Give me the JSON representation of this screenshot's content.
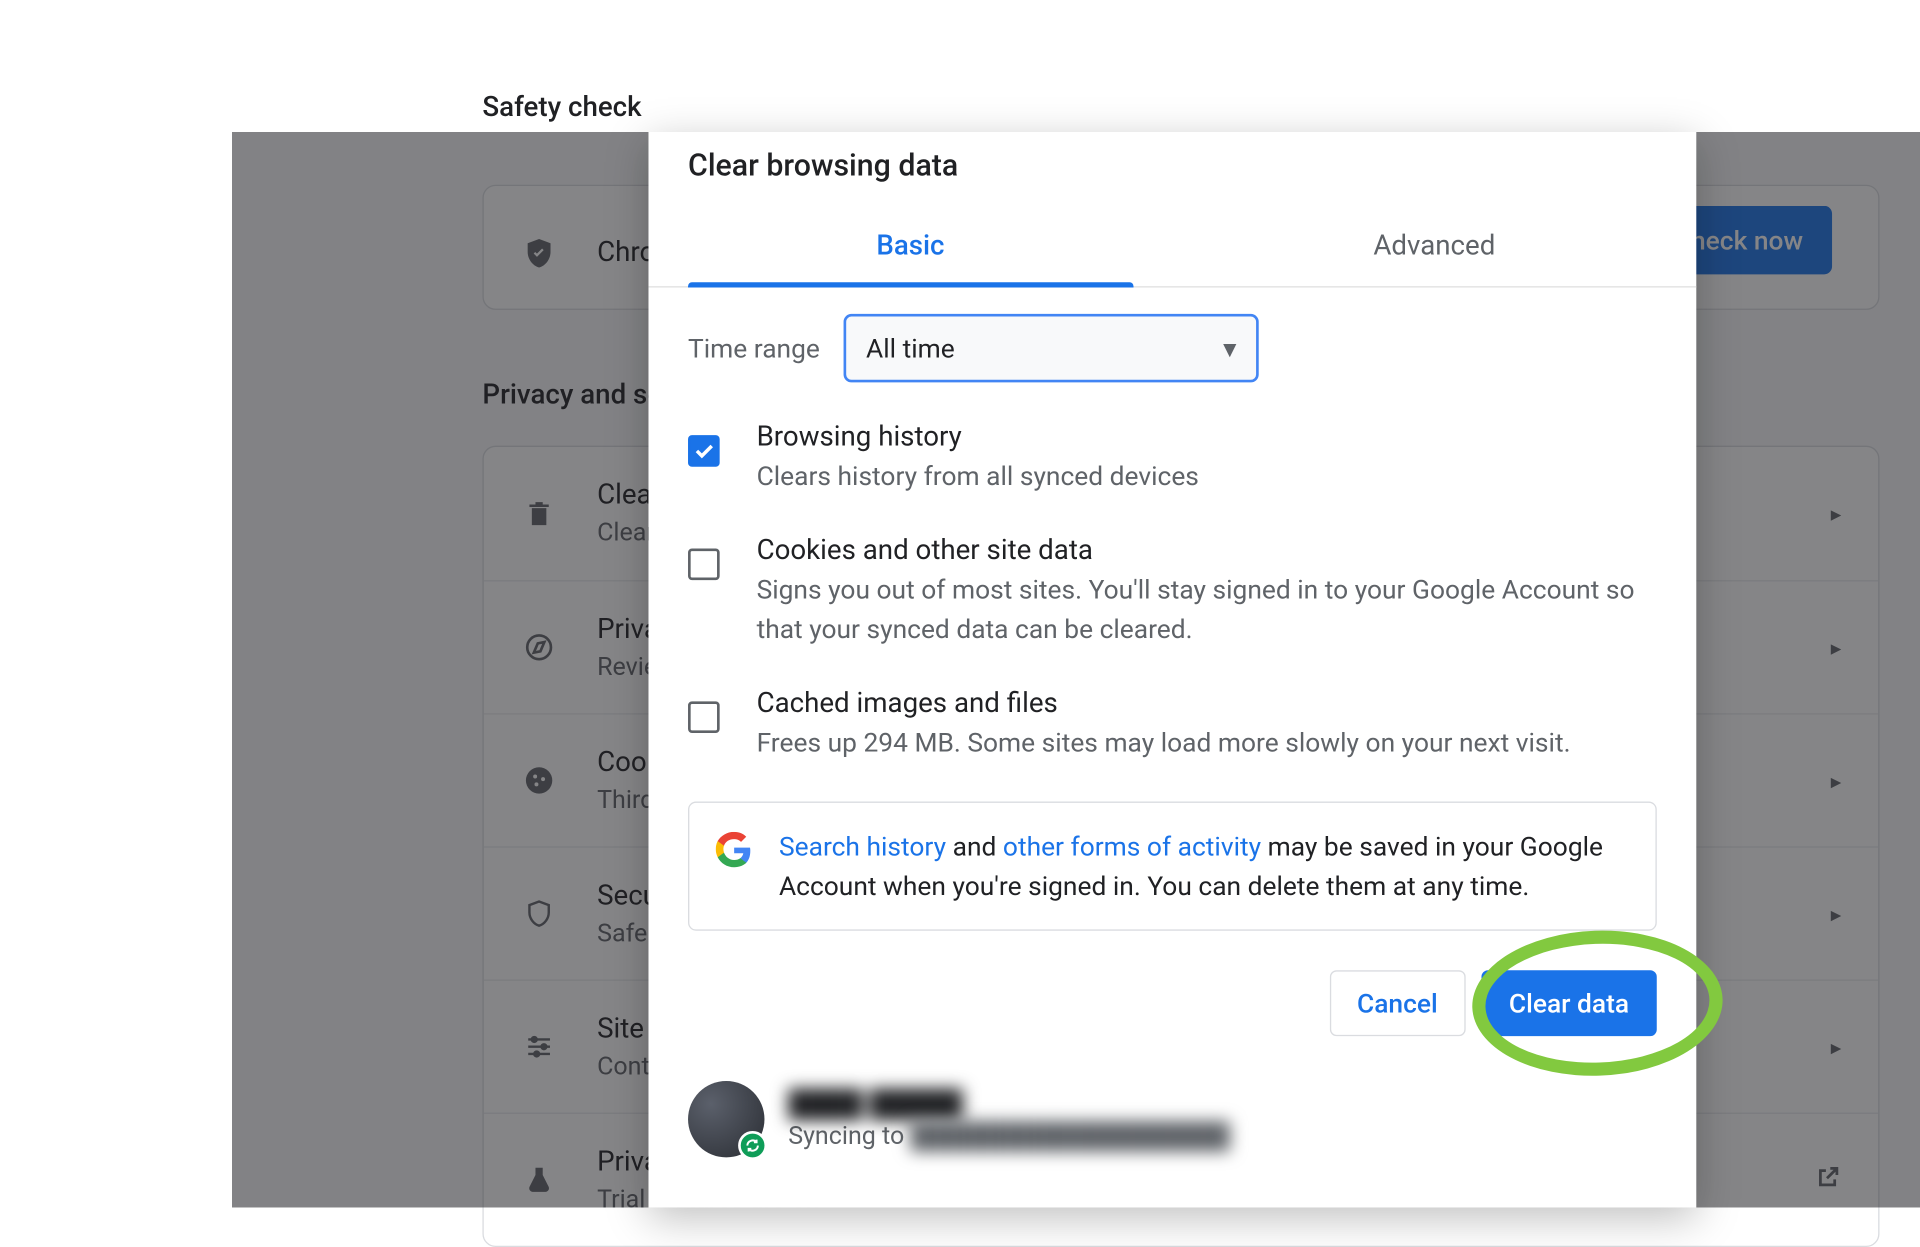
{
  "background": {
    "safety_section": "Safety check",
    "safety_row_text": "Chro",
    "check_now": "Check now",
    "privacy_section": "Privacy and security",
    "rows": [
      {
        "title": "Clear browsing data",
        "sub": "Clear history, cookies, cache, and more"
      },
      {
        "title": "Privacy Guide",
        "sub": "Review key privacy and security controls"
      },
      {
        "title": "Cookies and other site data",
        "sub": "Third-party cookies are blocked in Incognito mode"
      },
      {
        "title": "Security",
        "sub": "Safe Browsing (protection from dangerous sites) and other security settings"
      },
      {
        "title": "Site Settings",
        "sub": "Controls what information sites can use and show"
      },
      {
        "title": "Privacy Sandbox",
        "sub": "Trial features are on"
      }
    ]
  },
  "dialog": {
    "title": "Clear browsing data",
    "tabs": {
      "basic": "Basic",
      "advanced": "Advanced"
    },
    "time_label": "Time range",
    "time_value": "All time",
    "options": [
      {
        "checked": true,
        "title": "Browsing history",
        "sub": "Clears history from all synced devices"
      },
      {
        "checked": false,
        "title": "Cookies and other site data",
        "sub": "Signs you out of most sites. You'll stay signed in to your Google Account so that your synced data can be cleared."
      },
      {
        "checked": false,
        "title": "Cached images and files",
        "sub": "Frees up 294 MB. Some sites may load more slowly on your next visit."
      }
    ],
    "info": {
      "link1": "Search history",
      "mid": " and ",
      "link2": "other forms of activity",
      "rest": " may be saved in your Google Account when you're signed in. You can delete them at any time."
    },
    "cancel": "Cancel",
    "clear": "Clear data",
    "sync": {
      "name": "████ █████",
      "prefix": "Syncing to ",
      "email": "██████████████████"
    }
  }
}
